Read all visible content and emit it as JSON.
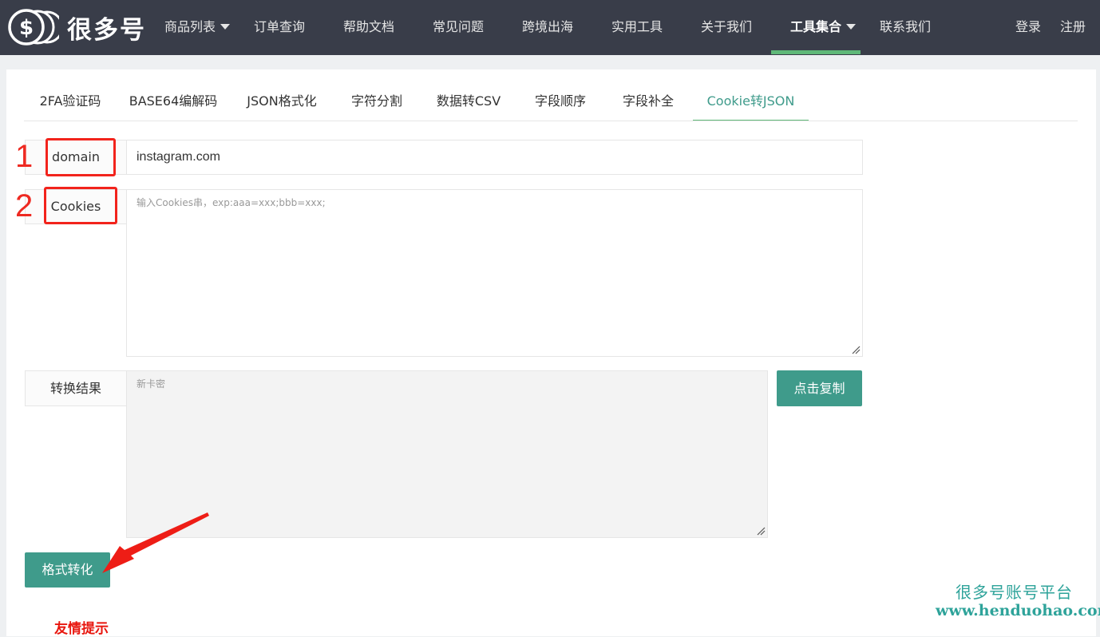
{
  "brand": {
    "name": "很多号",
    "logo_icon": "dollar-coins-icon"
  },
  "nav": {
    "items": [
      {
        "label": "商品列表",
        "dropdown": true
      },
      {
        "label": "订单查询"
      },
      {
        "label": "帮助文档"
      },
      {
        "label": "常见问题"
      },
      {
        "label": "跨境出海"
      },
      {
        "label": "实用工具"
      },
      {
        "label": "关于我们"
      },
      {
        "label": "工具集合",
        "dropdown": true,
        "active": true
      },
      {
        "label": "联系我们"
      }
    ],
    "login": "登录",
    "register": "注册"
  },
  "tabs": [
    {
      "label": "2FA验证码"
    },
    {
      "label": "BASE64编解码"
    },
    {
      "label": "JSON格式化"
    },
    {
      "label": "字符分割"
    },
    {
      "label": "数据转CSV"
    },
    {
      "label": "字段顺序"
    },
    {
      "label": "字段补全"
    },
    {
      "label": "Cookie转JSON",
      "active": true
    }
  ],
  "form": {
    "domain_label": "domain",
    "domain_value": "instagram.com",
    "cookies_label": "Cookies",
    "cookies_placeholder": "输入Cookies串，exp:aaa=xxx;bbb=xxx;",
    "result_label": "转换结果",
    "result_placeholder": "新卡密",
    "copy_button": "点击复制",
    "convert_button": "格式转化"
  },
  "annotations": {
    "marker_1": "1",
    "marker_2": "2",
    "color": "#f2231c"
  },
  "tip_text": "友情提示",
  "watermark": {
    "line1": "很多号账号平台",
    "line2": "www.henduohao.com"
  },
  "colors": {
    "nav_bg": "#393d49",
    "accent": "#3f9b8b",
    "active_bar": "#5fb878"
  }
}
